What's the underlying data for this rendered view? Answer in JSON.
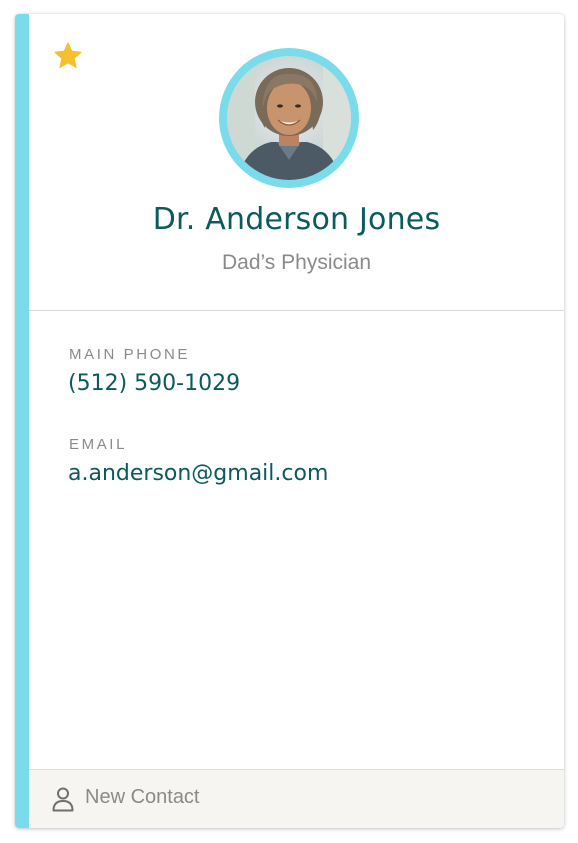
{
  "contact": {
    "name": "Dr. Anderson Jones",
    "relationship": "Dad’s Physician",
    "is_favorite": true,
    "avatar_icon": "person-photo"
  },
  "fields": [
    {
      "label": "MAIN PHONE",
      "value": "(512) 590-1029"
    },
    {
      "label": "EMAIL",
      "value": "a.anderson@gmail.com"
    }
  ],
  "footer": {
    "icon": "person-icon",
    "label": "New Contact"
  },
  "colors": {
    "accent": "#7adbea",
    "primary_text": "#0b5a5c",
    "muted_text": "#8a8a8a",
    "star": "#f6c02c",
    "footer_bg": "#f6f5f2"
  }
}
